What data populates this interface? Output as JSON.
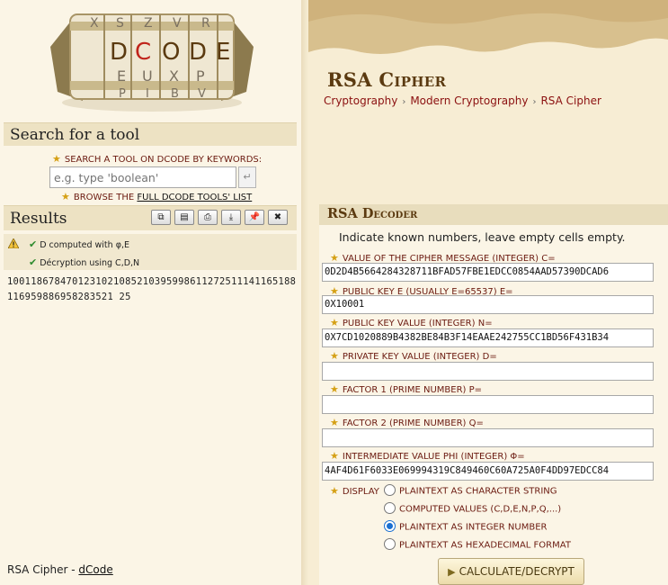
{
  "search": {
    "heading": "Search for a tool",
    "label": "SEARCH A TOOL ON DCODE BY KEYWORDS:",
    "placeholder": "e.g. type 'boolean'",
    "browse_prefix": "BROWSE THE ",
    "browse_link": "FULL DCODE TOOLS' LIST"
  },
  "logo": {
    "letters": [
      "D",
      "C",
      "O",
      "D",
      "E"
    ]
  },
  "results": {
    "heading": "Results",
    "buttons": [
      "copy-icon",
      "save-icon",
      "print-icon",
      "download-icon",
      "pin-icon",
      "close-icon"
    ],
    "messages": [
      "D computed with φ,E",
      "Décryption using C,D,N"
    ],
    "value": "1001186784701231021085210395998611272511141165188116959886958283521 25"
  },
  "footer": {
    "prefix": "RSA Cipher - ",
    "link": "dCode"
  },
  "page": {
    "title": "RSA Cipher",
    "breadcrumb": [
      "Cryptography",
      "Modern Cryptography",
      "RSA Cipher"
    ]
  },
  "decoder": {
    "heading": "RSA Decoder",
    "instructions": "Indicate known numbers, leave empty cells empty.",
    "fields": [
      {
        "label": "VALUE OF THE CIPHER MESSAGE (INTEGER) C=",
        "value": "0D2D4B5664284328711BFAD57FBE1EDCC0854AAD57390DCAD6"
      },
      {
        "label": "PUBLIC KEY E (USUALLY E=65537) E=",
        "value": "0X10001"
      },
      {
        "label": "PUBLIC KEY VALUE (INTEGER) N=",
        "value": "0X7CD1020889B4382BE84B3F14EAAE242755CC1BD56F431B34"
      },
      {
        "label": "PRIVATE KEY VALUE (INTEGER) D=",
        "value": ""
      },
      {
        "label": "FACTOR 1 (PRIME NUMBER) P=",
        "value": ""
      },
      {
        "label": "FACTOR 2 (PRIME NUMBER) Q=",
        "value": ""
      },
      {
        "label": "INTERMEDIATE VALUE PHI (INTEGER) Φ=",
        "value": "4AF4D61F6033E069994319C849460C60A725A0F4DD97EDCC84"
      }
    ],
    "display_label": "DISPLAY",
    "display_options": [
      {
        "label": "PLAINTEXT AS CHARACTER STRING",
        "selected": false
      },
      {
        "label": "COMPUTED VALUES (C,D,E,N,P,Q,...)",
        "selected": false
      },
      {
        "label": "PLAINTEXT AS INTEGER NUMBER",
        "selected": true
      },
      {
        "label": "PLAINTEXT AS HEXADECIMAL FORMAT",
        "selected": false
      }
    ],
    "submit_label": "CALCULATE/DECRYPT"
  }
}
